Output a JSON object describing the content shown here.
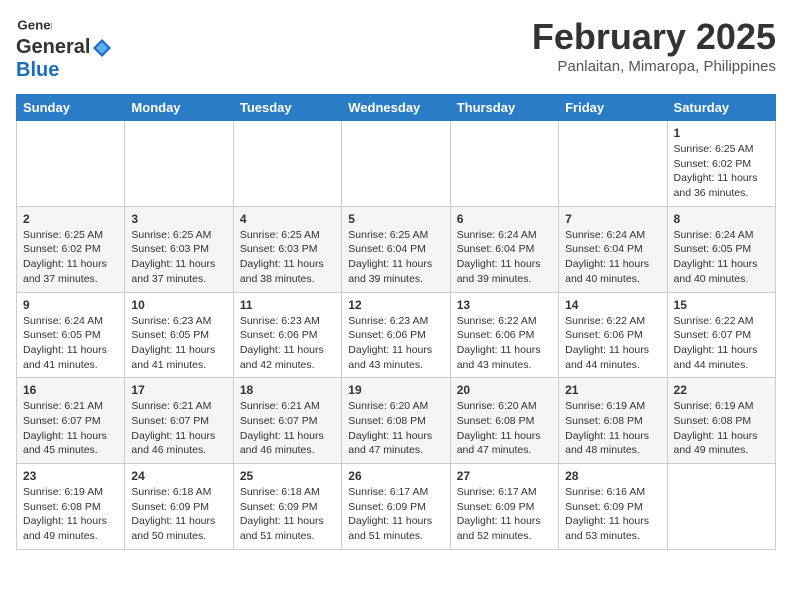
{
  "header": {
    "logo_general": "General",
    "logo_blue": "Blue",
    "title": "February 2025",
    "location": "Panlaitan, Mimaropa, Philippines"
  },
  "calendar": {
    "days_of_week": [
      "Sunday",
      "Monday",
      "Tuesday",
      "Wednesday",
      "Thursday",
      "Friday",
      "Saturday"
    ],
    "weeks": [
      [
        {
          "day": "",
          "info": ""
        },
        {
          "day": "",
          "info": ""
        },
        {
          "day": "",
          "info": ""
        },
        {
          "day": "",
          "info": ""
        },
        {
          "day": "",
          "info": ""
        },
        {
          "day": "",
          "info": ""
        },
        {
          "day": "1",
          "info": "Sunrise: 6:25 AM\nSunset: 6:02 PM\nDaylight: 11 hours\nand 36 minutes."
        }
      ],
      [
        {
          "day": "2",
          "info": "Sunrise: 6:25 AM\nSunset: 6:02 PM\nDaylight: 11 hours\nand 37 minutes."
        },
        {
          "day": "3",
          "info": "Sunrise: 6:25 AM\nSunset: 6:03 PM\nDaylight: 11 hours\nand 37 minutes."
        },
        {
          "day": "4",
          "info": "Sunrise: 6:25 AM\nSunset: 6:03 PM\nDaylight: 11 hours\nand 38 minutes."
        },
        {
          "day": "5",
          "info": "Sunrise: 6:25 AM\nSunset: 6:04 PM\nDaylight: 11 hours\nand 39 minutes."
        },
        {
          "day": "6",
          "info": "Sunrise: 6:24 AM\nSunset: 6:04 PM\nDaylight: 11 hours\nand 39 minutes."
        },
        {
          "day": "7",
          "info": "Sunrise: 6:24 AM\nSunset: 6:04 PM\nDaylight: 11 hours\nand 40 minutes."
        },
        {
          "day": "8",
          "info": "Sunrise: 6:24 AM\nSunset: 6:05 PM\nDaylight: 11 hours\nand 40 minutes."
        }
      ],
      [
        {
          "day": "9",
          "info": "Sunrise: 6:24 AM\nSunset: 6:05 PM\nDaylight: 11 hours\nand 41 minutes."
        },
        {
          "day": "10",
          "info": "Sunrise: 6:23 AM\nSunset: 6:05 PM\nDaylight: 11 hours\nand 41 minutes."
        },
        {
          "day": "11",
          "info": "Sunrise: 6:23 AM\nSunset: 6:06 PM\nDaylight: 11 hours\nand 42 minutes."
        },
        {
          "day": "12",
          "info": "Sunrise: 6:23 AM\nSunset: 6:06 PM\nDaylight: 11 hours\nand 43 minutes."
        },
        {
          "day": "13",
          "info": "Sunrise: 6:22 AM\nSunset: 6:06 PM\nDaylight: 11 hours\nand 43 minutes."
        },
        {
          "day": "14",
          "info": "Sunrise: 6:22 AM\nSunset: 6:06 PM\nDaylight: 11 hours\nand 44 minutes."
        },
        {
          "day": "15",
          "info": "Sunrise: 6:22 AM\nSunset: 6:07 PM\nDaylight: 11 hours\nand 44 minutes."
        }
      ],
      [
        {
          "day": "16",
          "info": "Sunrise: 6:21 AM\nSunset: 6:07 PM\nDaylight: 11 hours\nand 45 minutes."
        },
        {
          "day": "17",
          "info": "Sunrise: 6:21 AM\nSunset: 6:07 PM\nDaylight: 11 hours\nand 46 minutes."
        },
        {
          "day": "18",
          "info": "Sunrise: 6:21 AM\nSunset: 6:07 PM\nDaylight: 11 hours\nand 46 minutes."
        },
        {
          "day": "19",
          "info": "Sunrise: 6:20 AM\nSunset: 6:08 PM\nDaylight: 11 hours\nand 47 minutes."
        },
        {
          "day": "20",
          "info": "Sunrise: 6:20 AM\nSunset: 6:08 PM\nDaylight: 11 hours\nand 47 minutes."
        },
        {
          "day": "21",
          "info": "Sunrise: 6:19 AM\nSunset: 6:08 PM\nDaylight: 11 hours\nand 48 minutes."
        },
        {
          "day": "22",
          "info": "Sunrise: 6:19 AM\nSunset: 6:08 PM\nDaylight: 11 hours\nand 49 minutes."
        }
      ],
      [
        {
          "day": "23",
          "info": "Sunrise: 6:19 AM\nSunset: 6:08 PM\nDaylight: 11 hours\nand 49 minutes."
        },
        {
          "day": "24",
          "info": "Sunrise: 6:18 AM\nSunset: 6:09 PM\nDaylight: 11 hours\nand 50 minutes."
        },
        {
          "day": "25",
          "info": "Sunrise: 6:18 AM\nSunset: 6:09 PM\nDaylight: 11 hours\nand 51 minutes."
        },
        {
          "day": "26",
          "info": "Sunrise: 6:17 AM\nSunset: 6:09 PM\nDaylight: 11 hours\nand 51 minutes."
        },
        {
          "day": "27",
          "info": "Sunrise: 6:17 AM\nSunset: 6:09 PM\nDaylight: 11 hours\nand 52 minutes."
        },
        {
          "day": "28",
          "info": "Sunrise: 6:16 AM\nSunset: 6:09 PM\nDaylight: 11 hours\nand 53 minutes."
        },
        {
          "day": "",
          "info": ""
        }
      ]
    ]
  }
}
